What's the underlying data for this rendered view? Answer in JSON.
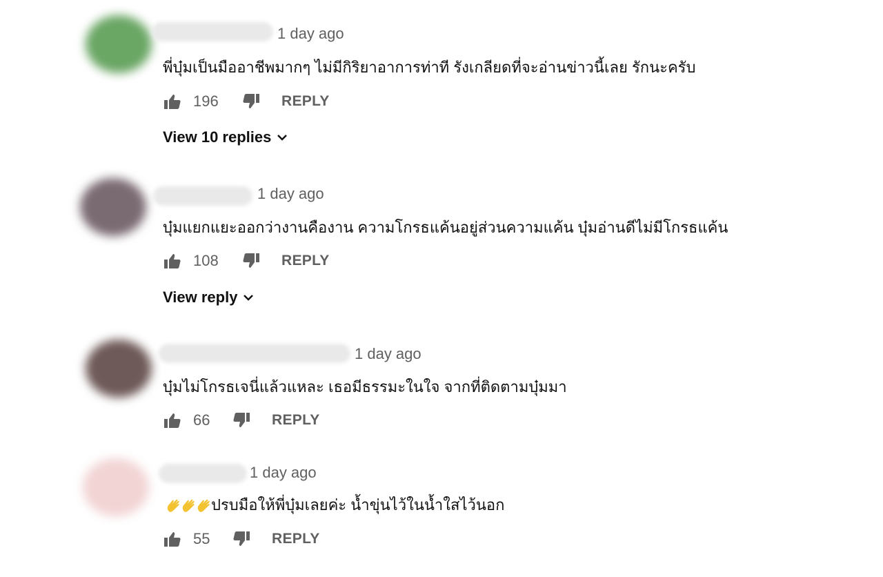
{
  "comments": [
    {
      "time": "1 day ago",
      "text": "พี่บุ๋มเป็นมืออาชีพมากๆ  ไม่มีกิริยาอาการท่าที  รังเกลียดที่จะอ่านข่าวนี้เลย  รักนะครับ",
      "likes": "196",
      "reply_label": "REPLY",
      "view_replies": "View 10 replies",
      "avatar_color": "#6aa664"
    },
    {
      "time": "1 day ago",
      "text": "บุ๋มแยกแยะออกว่างานคืองาน ความโกรธแค้นอยู่ส่วนความแค้น บุ๋มอ่านดีไม่มีโกรธแค้น",
      "likes": "108",
      "reply_label": "REPLY",
      "view_replies": "View reply",
      "avatar_color": "#7a6a72"
    },
    {
      "time": "1 day ago",
      "text": "บุ๋มไม่โกรธเจนี่แล้วแหละ เธอมีธรรมะในใจ จากที่ติดตามบุ๋มมา",
      "likes": "66",
      "reply_label": "REPLY",
      "avatar_color": "#6e5a58"
    },
    {
      "time": "1 day ago",
      "text": "ปรบมือให้พี่บุ๋มเลยค่ะ น้ำขุ่นไว้ในน้ำใสไว้นอก",
      "likes": "55",
      "reply_label": "REPLY",
      "avatar_color": "#f2d4d4",
      "emoji": "clapping-hands"
    }
  ],
  "colors": {
    "meta": "#606060",
    "text": "#111111",
    "clap": "#f2c230"
  }
}
